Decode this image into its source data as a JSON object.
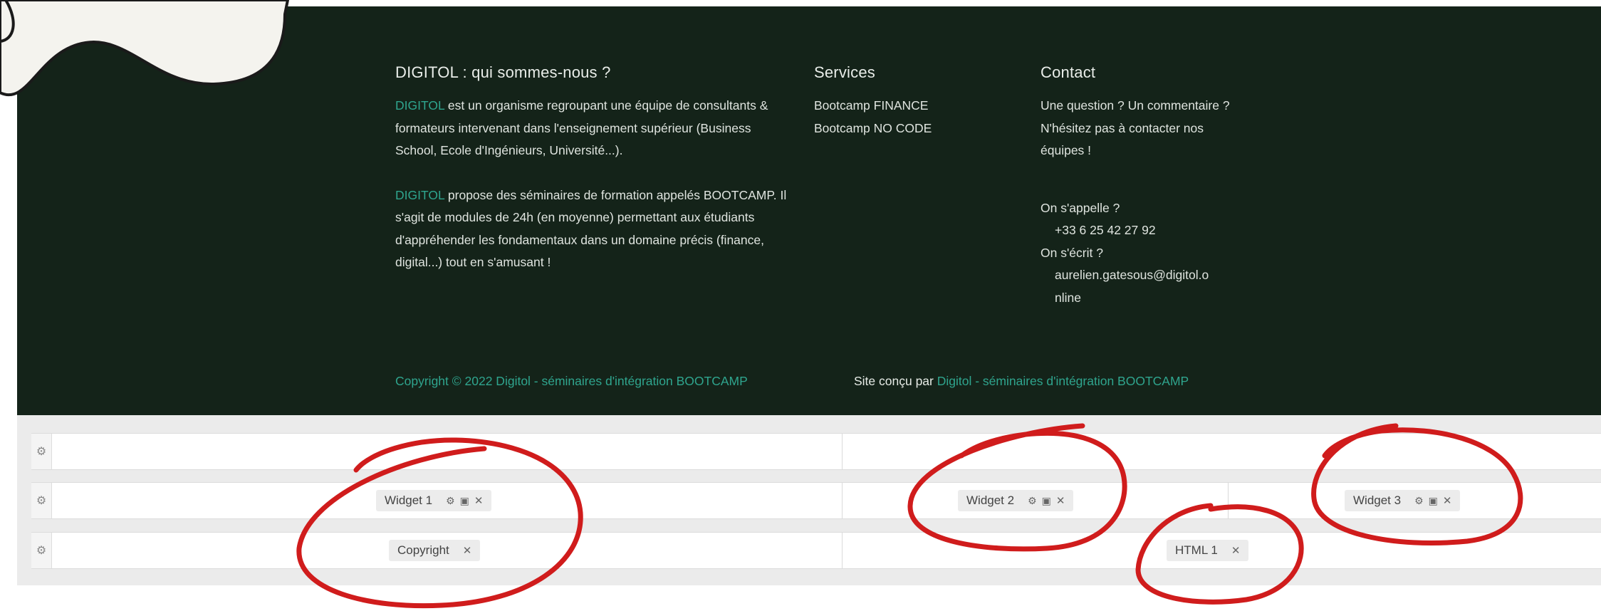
{
  "footer": {
    "about": {
      "heading": "DIGITOL : qui sommes-nous ?",
      "p1_brand": "DIGITOL",
      "p1_text": " est un organisme regroupant une équipe de consultants & formateurs intervenant dans l'enseignement supérieur (Business School, Ecole d'Ingénieurs, Université...).",
      "p2_brand": "DIGITOL",
      "p2_text": " propose des séminaires de formation appelés BOOTCAMP. Il s'agit de modules de 24h (en moyenne) permettant aux étudiants d'appréhender les fondamentaux dans un domaine précis (finance, digital...) tout en s'amusant !"
    },
    "services": {
      "heading": "Services",
      "items": [
        "Bootcamp FINANCE",
        "Bootcamp NO CODE"
      ]
    },
    "contact": {
      "heading": "Contact",
      "intro": "Une question ? Un commentaire ? N'hésitez pas à contacter nos équipes !",
      "call_label": "On s'appelle ?",
      "phone": "+33 6 25 42 27 92",
      "write_label": "On s'écrit ?",
      "email_line1": "aurelien.gatesous@digitol.o",
      "email_line2": "nline"
    },
    "copyright": "Copyright © 2022 Digitol - séminaires d'intégration BOOTCAMP",
    "credit_prefix": "Site conçu par ",
    "credit_link": "Digitol - séminaires d'intégration BOOTCAMP"
  },
  "builder": {
    "widgets": {
      "w1": "Widget 1",
      "w2": "Widget 2",
      "w3": "Widget 3",
      "copyright": "Copyright",
      "html1": "HTML 1"
    },
    "icons": {
      "row_settings": "gear-icon",
      "widget_settings": "gear-icon",
      "widget_layout": "layout-icon",
      "widget_remove": "close-icon"
    }
  },
  "colors": {
    "footer_bg": "#142319",
    "accent": "#2fa58e",
    "annotation": "#d01c1c"
  }
}
